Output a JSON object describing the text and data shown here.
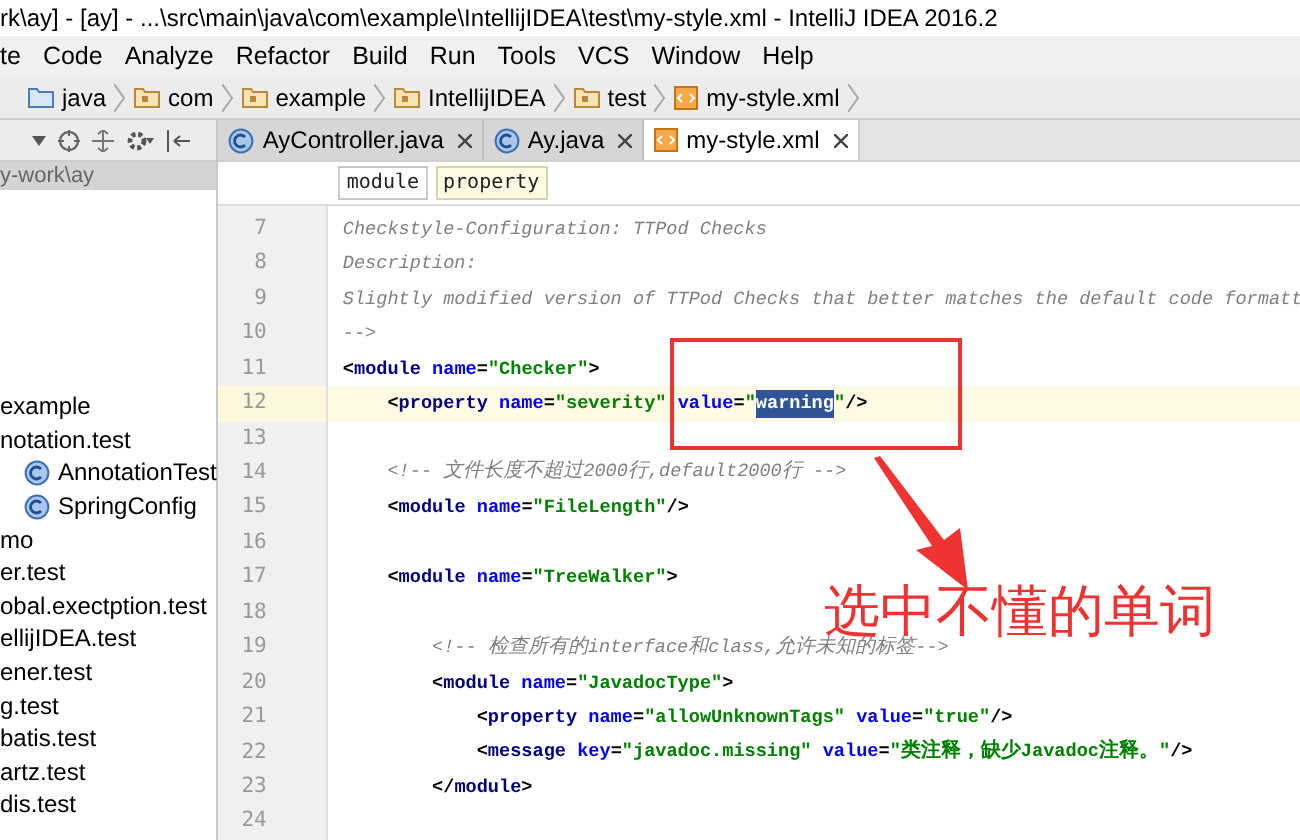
{
  "window": {
    "title": "rk\\ay] - [ay] - ...\\src\\main\\java\\com\\example\\IntellijIDEA\\test\\my-style.xml - IntelliJ IDEA 2016.2"
  },
  "menu": [
    "te",
    "Code",
    "Analyze",
    "Refactor",
    "Build",
    "Run",
    "Tools",
    "VCS",
    "Window",
    "Help"
  ],
  "navigation": [
    {
      "label": "java",
      "kind": "source"
    },
    {
      "label": "com",
      "kind": "package"
    },
    {
      "label": "example",
      "kind": "package"
    },
    {
      "label": "IntellijIDEA",
      "kind": "package"
    },
    {
      "label": "test",
      "kind": "package"
    },
    {
      "label": "my-style.xml",
      "kind": "xml"
    }
  ],
  "tabs": [
    {
      "label": "AyController.java",
      "kind": "class",
      "selected": false
    },
    {
      "label": "Ay.java",
      "kind": "class",
      "selected": false
    },
    {
      "label": "my-style.xml",
      "kind": "xml",
      "selected": true
    }
  ],
  "project": {
    "header": "y-work\\ay",
    "items": [
      {
        "label": "example",
        "kind": "package"
      },
      {
        "label": "notation.test",
        "kind": "package"
      },
      {
        "label": "AnnotationTest",
        "kind": "class"
      },
      {
        "label": "SpringConfig",
        "kind": "class"
      },
      {
        "label": "mo",
        "kind": "package"
      },
      {
        "label": "er.test",
        "kind": "package"
      },
      {
        "label": "obal.exectption.test",
        "kind": "package"
      },
      {
        "label": "ellijIDEA.test",
        "kind": "package"
      },
      {
        "label": "ener.test",
        "kind": "package"
      },
      {
        "label": "g.test",
        "kind": "package"
      },
      {
        "label": "batis.test",
        "kind": "package"
      },
      {
        "label": "artz.test",
        "kind": "package"
      },
      {
        "label": "dis.test",
        "kind": "package"
      }
    ]
  },
  "editor_breadcrumbs": [
    {
      "label": "module",
      "selected": false
    },
    {
      "label": "property",
      "selected": true
    }
  ],
  "code_lines": [
    {
      "number": "7",
      "current": false,
      "segments": [
        {
          "kind": "comment",
          "text": "Checkstyle-Configuration: TTPod Checks"
        }
      ]
    },
    {
      "number": "8",
      "current": false,
      "segments": [
        {
          "kind": "comment",
          "text": "Description:"
        }
      ]
    },
    {
      "number": "9",
      "current": false,
      "segments": [
        {
          "kind": "comment",
          "text": "Slightly modified version of TTPod Checks that better matches the default code formatt"
        }
      ]
    },
    {
      "number": "10",
      "current": false,
      "segments": [
        {
          "kind": "comment",
          "text": "-->"
        }
      ]
    },
    {
      "number": "11",
      "current": false,
      "segments": [
        {
          "kind": "punct",
          "text": "<"
        },
        {
          "kind": "tag",
          "text": "module"
        },
        {
          "kind": "attr",
          "text": " name"
        },
        {
          "kind": "punct",
          "text": "="
        },
        {
          "kind": "string",
          "text": "\"Checker\""
        },
        {
          "kind": "punct",
          "text": ">"
        }
      ]
    },
    {
      "number": "12",
      "current": true,
      "segments": [
        {
          "kind": "punct",
          "text": "    <"
        },
        {
          "kind": "tag",
          "text": "property"
        },
        {
          "kind": "attr",
          "text": " name"
        },
        {
          "kind": "punct",
          "text": "="
        },
        {
          "kind": "string",
          "text": "\"severity\""
        },
        {
          "kind": "attr",
          "text": " value"
        },
        {
          "kind": "punct",
          "text": "="
        },
        {
          "kind": "string",
          "text": "\""
        },
        {
          "kind": "selection",
          "text": "warning"
        },
        {
          "kind": "string",
          "text": "\""
        },
        {
          "kind": "punct",
          "text": "/>"
        }
      ]
    },
    {
      "number": "13",
      "current": false
    },
    {
      "number": "14",
      "current": false,
      "segments": [
        {
          "kind": "comment",
          "text": "    <!-- 文件长度不超过2000行,default2000行 -->"
        }
      ]
    },
    {
      "number": "15",
      "current": false,
      "segments": [
        {
          "kind": "punct",
          "text": "    <"
        },
        {
          "kind": "tag",
          "text": "module"
        },
        {
          "kind": "attr",
          "text": " name"
        },
        {
          "kind": "punct",
          "text": "="
        },
        {
          "kind": "string",
          "text": "\"FileLength\""
        },
        {
          "kind": "punct",
          "text": "/>"
        }
      ]
    },
    {
      "number": "16",
      "current": false
    },
    {
      "number": "17",
      "current": false,
      "segments": [
        {
          "kind": "punct",
          "text": "    <"
        },
        {
          "kind": "tag",
          "text": "module"
        },
        {
          "kind": "attr",
          "text": " name"
        },
        {
          "kind": "punct",
          "text": "="
        },
        {
          "kind": "string",
          "text": "\"TreeWalker\""
        },
        {
          "kind": "punct",
          "text": ">"
        }
      ]
    },
    {
      "number": "18",
      "current": false
    },
    {
      "number": "19",
      "current": false,
      "segments": [
        {
          "kind": "comment",
          "text": "        <!-- 检查所有的interface和class,允许未知的标签-->"
        }
      ]
    },
    {
      "number": "20",
      "current": false,
      "segments": [
        {
          "kind": "punct",
          "text": "        <"
        },
        {
          "kind": "tag",
          "text": "module"
        },
        {
          "kind": "attr",
          "text": " name"
        },
        {
          "kind": "punct",
          "text": "="
        },
        {
          "kind": "string",
          "text": "\"JavadocType\""
        },
        {
          "kind": "punct",
          "text": ">"
        }
      ]
    },
    {
      "number": "21",
      "current": false,
      "segments": [
        {
          "kind": "punct",
          "text": "            <"
        },
        {
          "kind": "tag",
          "text": "property"
        },
        {
          "kind": "attr",
          "text": " name"
        },
        {
          "kind": "punct",
          "text": "="
        },
        {
          "kind": "string",
          "text": "\"allowUnknownTags\""
        },
        {
          "kind": "attr",
          "text": " value"
        },
        {
          "kind": "punct",
          "text": "="
        },
        {
          "kind": "string",
          "text": "\"true\""
        },
        {
          "kind": "punct",
          "text": "/>"
        }
      ]
    },
    {
      "number": "22",
      "current": false,
      "segments": [
        {
          "kind": "punct",
          "text": "            <"
        },
        {
          "kind": "tag",
          "text": "message"
        },
        {
          "kind": "attr",
          "text": " key"
        },
        {
          "kind": "punct",
          "text": "="
        },
        {
          "kind": "string",
          "text": "\"javadoc.missing\""
        },
        {
          "kind": "attr",
          "text": " value"
        },
        {
          "kind": "punct",
          "text": "="
        },
        {
          "kind": "string",
          "text": "\"类注释，缺少Javadoc注释。\""
        },
        {
          "kind": "punct",
          "text": "/>"
        }
      ]
    },
    {
      "number": "23",
      "current": false,
      "segments": [
        {
          "kind": "punct",
          "text": "        </"
        },
        {
          "kind": "tag",
          "text": "module"
        },
        {
          "kind": "punct",
          "text": ">"
        }
      ]
    },
    {
      "number": "24",
      "current": false
    }
  ],
  "annotation": {
    "text": "选中不懂的单词"
  }
}
